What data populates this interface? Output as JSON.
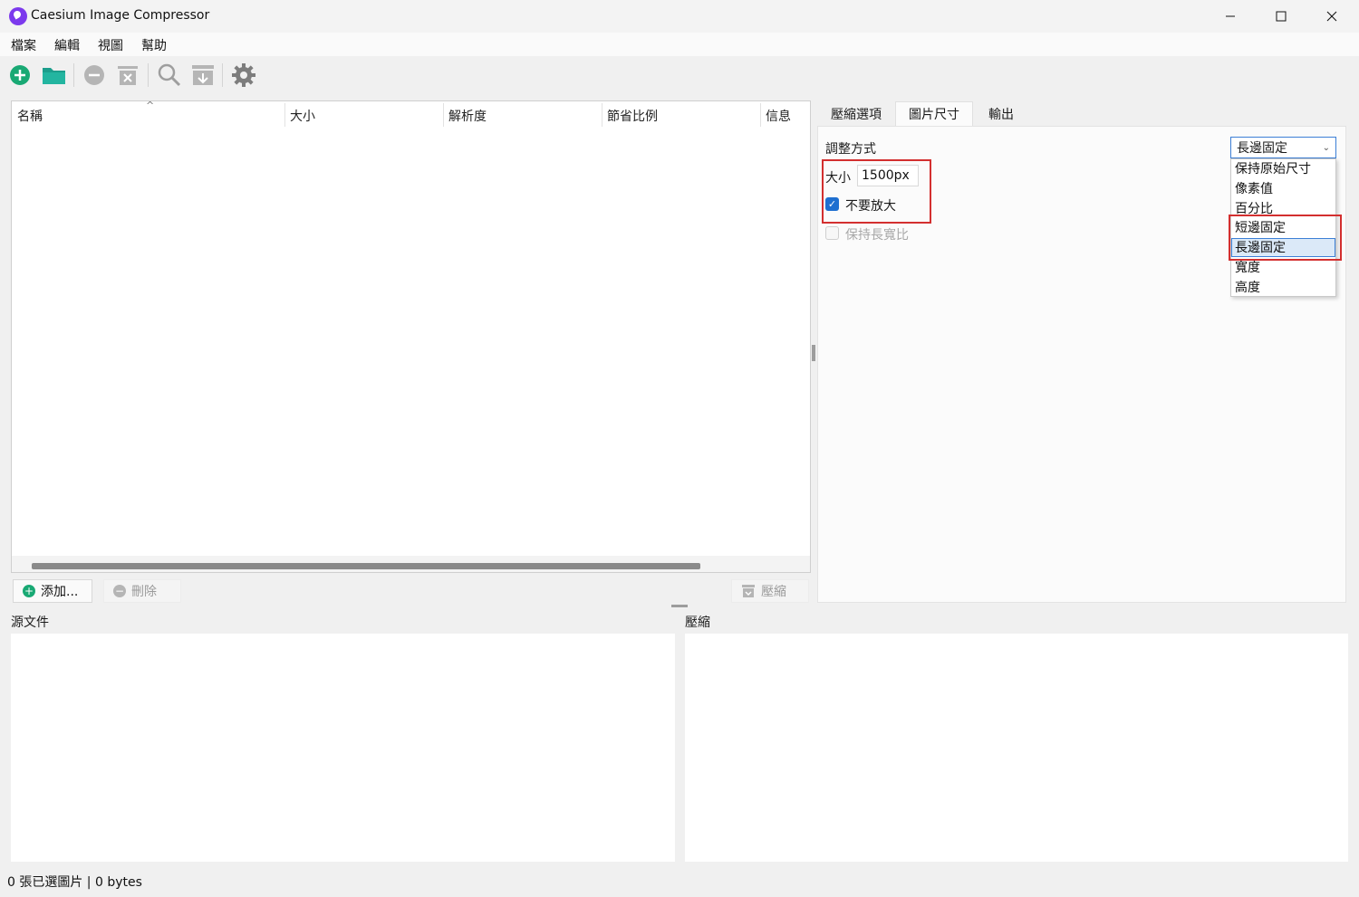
{
  "window": {
    "title": "Caesium Image Compressor"
  },
  "menu": {
    "items": [
      "檔案",
      "編輯",
      "視圖",
      "幫助"
    ]
  },
  "toolbar": {
    "icons": [
      "add-icon",
      "folder-open-icon",
      "remove-icon",
      "clear-list-icon",
      "search-icon",
      "compress-icon",
      "settings-icon"
    ]
  },
  "table": {
    "columns": [
      "名稱",
      "大小",
      "解析度",
      "節省比例",
      "信息"
    ],
    "rows": []
  },
  "actions": {
    "add_label": "添加...",
    "delete_label": "刪除",
    "compress_label": "壓縮"
  },
  "tabs": {
    "items": [
      "壓縮選項",
      "圖片尺寸",
      "輸出"
    ],
    "active": "圖片尺寸"
  },
  "resize": {
    "method_label": "調整方式",
    "size_label": "大小",
    "size_value": "1500px",
    "no_enlarge_label": "不要放大",
    "no_enlarge_checked": true,
    "keep_ratio_label": "保持長寬比",
    "keep_ratio_checked": false,
    "selected_option": "長邊固定",
    "options": [
      "保持原始尺寸",
      "像素值",
      "百分比",
      "短邊固定",
      "長邊固定",
      "寬度",
      "高度"
    ]
  },
  "preview": {
    "source_label": "源文件",
    "compressed_label": "壓縮"
  },
  "status": {
    "text": "0 張已選圖片 | 0 bytes"
  },
  "colors": {
    "accent": "#1f6fd0",
    "add_green": "#19a974",
    "folder_teal": "#1c9e8c",
    "highlight_red": "#d32f2f",
    "app_logo": "#7c3aed"
  }
}
